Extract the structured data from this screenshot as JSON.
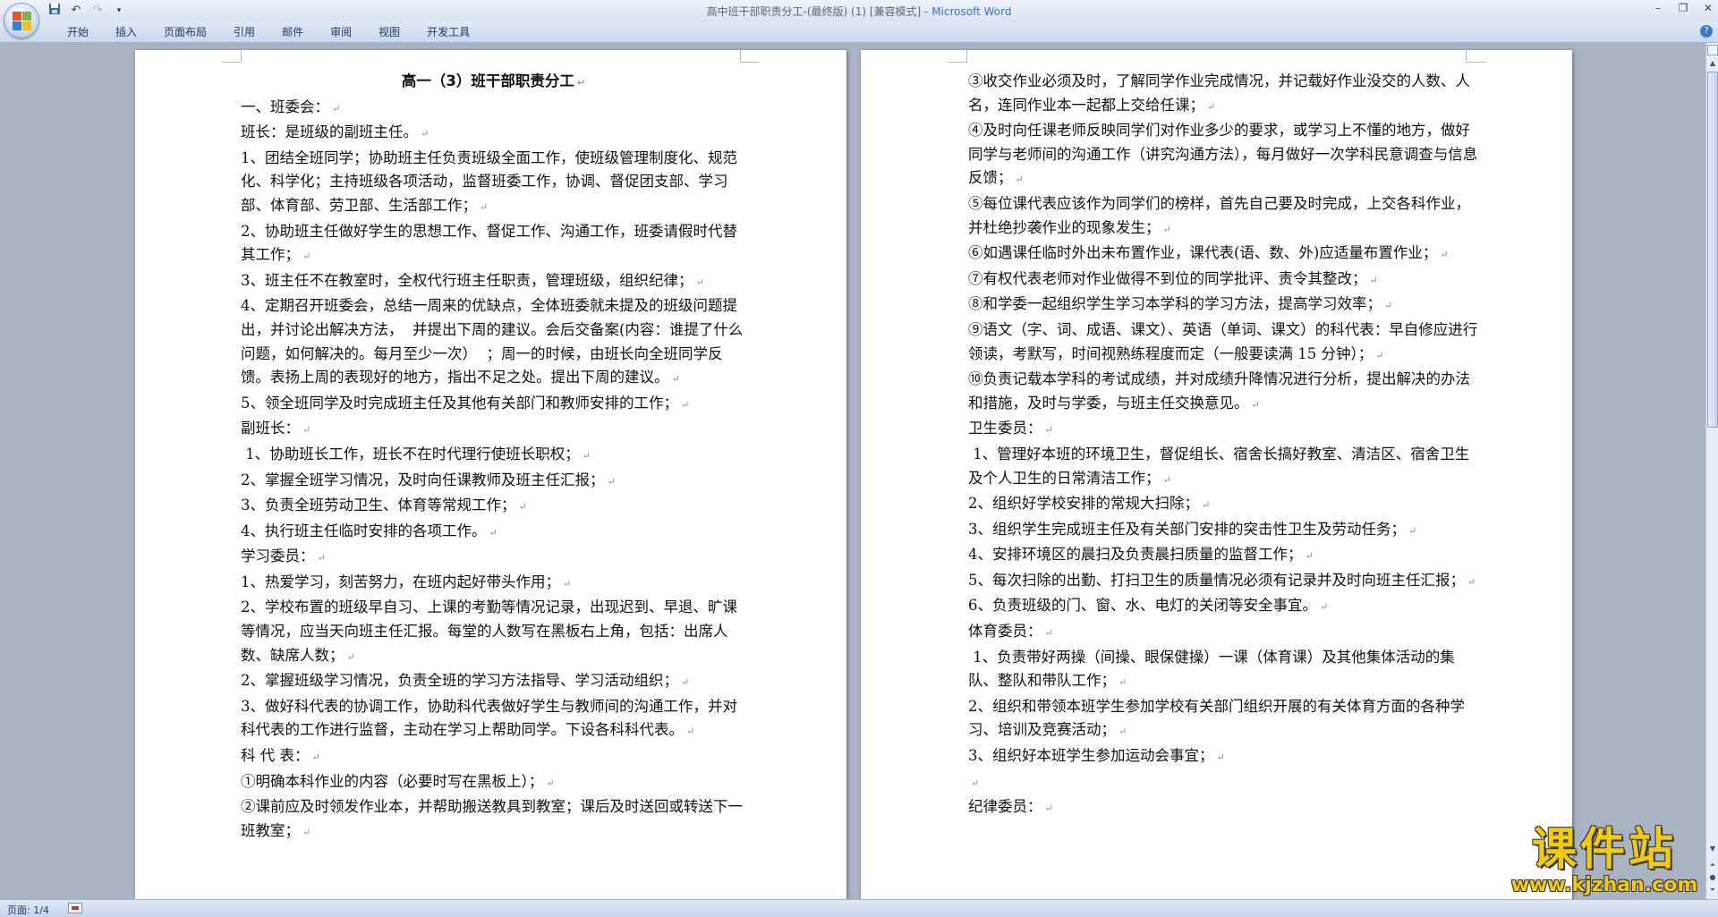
{
  "window": {
    "title": "高中班干部职责分工-(最终版) (1) [兼容模式]",
    "app_name": "Microsoft Word",
    "title_separator": " - "
  },
  "quick_access": {
    "save_icon": "save-icon",
    "undo_icon": "undo-icon",
    "redo_icon": "redo-icon",
    "customize_icon": "customize-icon"
  },
  "ribbon": {
    "tabs": [
      "开始",
      "插入",
      "页面布局",
      "引用",
      "邮件",
      "审阅",
      "视图",
      "开发工具"
    ]
  },
  "page1": {
    "heading": "高一（3）班干部职责分工",
    "paragraphs": [
      "一、班委会：",
      "班长：是班级的副班主任。",
      "1、团结全班同学；协助班主任负责班级全面工作，使班级管理制度化、规范化、科学化；主持班级各项活动，监督班委工作，协调、督促团支部、学习部、体育部、劳卫部、生活部工作；",
      "2、协助班主任做好学生的思想工作、督促工作、沟通工作，班委请假时代替其工作；",
      "3、班主任不在教室时，全权代行班主任职责，管理班级，组织纪律；",
      "4、定期召开班委会，总结一周来的优缺点，全体班委就未提及的班级问题提出，并讨论出解决方法，  并提出下周的建议。会后交备案(内容：谁提了什么问题，如何解决的。每月至少一次）  ；周一的时候，由班长向全班同学反馈。表扬上周的表现好的地方，指出不足之处。提出下周的建议。",
      "5、领全班同学及时完成班主任及其他有关部门和教师安排的工作；",
      "副班长：",
      " 1、协助班长工作，班长不在时代理行使班长职权；",
      "2、掌握全班学习情况，及时向任课教师及班主任汇报；",
      "3、负责全班劳动卫生、体育等常规工作；",
      "4、执行班主任临时安排的各项工作。",
      "学习委员：",
      "1、热爱学习，刻苦努力，在班内起好带头作用；",
      "2、学校布置的班级早自习、上课的考勤等情况记录，出现迟到、早退、旷课等情况，应当天向班主任汇报。每堂的人数写在黑板右上角，包括：出席人数、缺席人数；",
      "2、掌握班级学习情况，负责全班的学习方法指导、学习活动组织；",
      "3、做好科代表的协调工作，协助科代表做好学生与教师间的沟通工作，并对科代表的工作进行监督，主动在学习上帮助同学。下设各科科代表。",
      "科 代 表：",
      "①明确本科作业的内容（必要时写在黑板上）；",
      "②课前应及时领发作业本，并帮助搬送教具到教室；课后及时送回或转送下一班教室；"
    ]
  },
  "page2": {
    "paragraphs": [
      "③收交作业必须及时，了解同学作业完成情况，并记载好作业没交的人数、人名，连同作业本一起都上交给任课；",
      "④及时向任课老师反映同学们对作业多少的要求，或学习上不懂的地方，做好同学与老师间的沟通工作（讲究沟通方法），每月做好一次学科民意调查与信息反馈；",
      "⑤每位课代表应该作为同学们的榜样，首先自己要及时完成，上交各科作业，并杜绝抄袭作业的现象发生；",
      "⑥如遇课任临时外出未布置作业，课代表(语、数、外)应适量布置作业；",
      "⑦有权代表老师对作业做得不到位的同学批评、责令其整改；",
      "⑧和学委一起组织学生学习本学科的学习方法，提高学习效率；",
      "⑨语文（字、词、成语、课文）、英语（单词、课文）的科代表：早自修应进行领读，考默写，时间视熟练程度而定（一般要读满 15 分钟）；",
      "⑩负责记载本学科的考试成绩，并对成绩升降情况进行分析，提出解决的办法和措施，及时与学委，与班主任交换意见。",
      "卫生委员：",
      " 1、管理好本班的环境卫生，督促组长、宿舍长搞好教室、清洁区、宿舍卫生及个人卫生的日常清洁工作；",
      "2、组织好学校安排的常规大扫除；",
      "3、组织学生完成班主任及有关部门安排的突击性卫生及劳动任务；",
      "4、安排环境区的晨扫及负责晨扫质量的监督工作；",
      "5、每次扫除的出勤、打扫卫生的质量情况必须有记录并及时向班主任汇报；",
      "6、负责班级的门、窗、水、电灯的关闭等安全事宜。",
      "体育委员：",
      " 1、负责带好两操（间操、眼保健操）一课（体育课）及其他集体活动的集队、整队和带队工作；",
      "2、组织和带领本班学生参加学校有关部门组织开展的有关体育方面的各种学习、培训及竞赛活动；",
      "3、组织好本班学生参加运动会事宜；",
      "",
      "纪律委员："
    ]
  },
  "statusbar": {
    "page_info": "页面: 1/4"
  },
  "watermark": {
    "main": "课件站",
    "url": "www.kjzhan.com"
  },
  "colors": {
    "ribbon_bg": "#d9e4f2",
    "doc_bg": "#a9b3c2",
    "watermark": "#f2cc0c",
    "app_title": "#3a73c0"
  }
}
